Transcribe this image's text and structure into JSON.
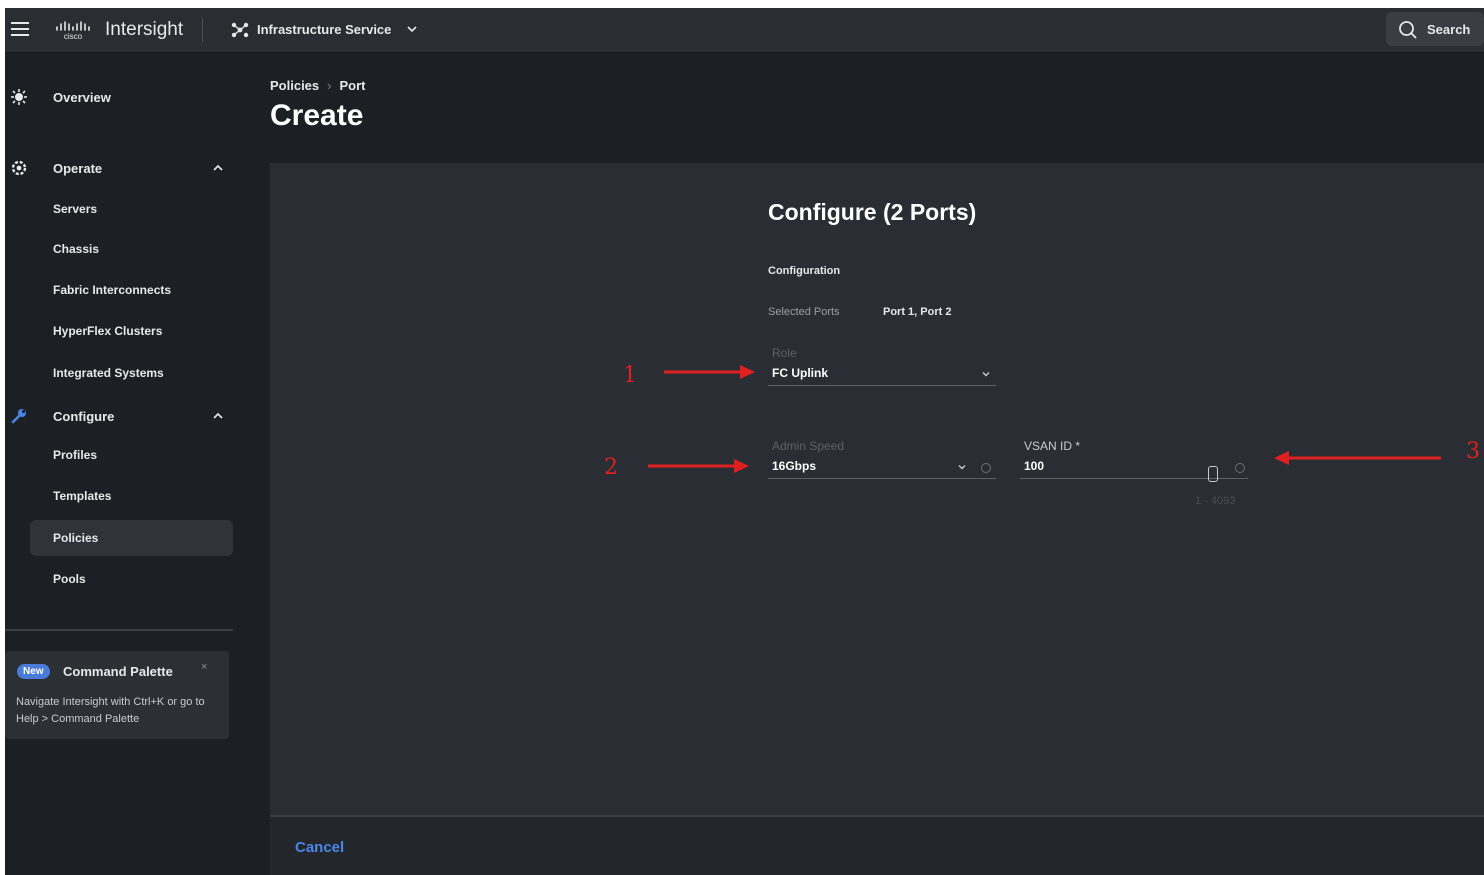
{
  "topbar": {
    "app_name": "Intersight",
    "service_name": "Infrastructure Service",
    "search_label": "Search"
  },
  "sidebar": {
    "overview": "Overview",
    "operate": "Operate",
    "operate_items": [
      "Servers",
      "Chassis",
      "Fabric Interconnects",
      "HyperFlex Clusters",
      "Integrated Systems"
    ],
    "configure": "Configure",
    "configure_items": [
      "Profiles",
      "Templates",
      "Policies",
      "Pools"
    ],
    "active_item": "Policies"
  },
  "palette": {
    "badge": "New",
    "title": "Command Palette",
    "close": "×",
    "description": "Navigate Intersight with Ctrl+K or go to Help > Command Palette"
  },
  "header": {
    "breadcrumb": [
      "Policies",
      "Port"
    ],
    "title": "Create"
  },
  "form": {
    "title": "Configure (2 Ports)",
    "section": "Configuration",
    "selected_ports_label": "Selected Ports",
    "selected_ports_value": "Port 1, Port 2",
    "role_label": "Role",
    "role_value": "FC Uplink",
    "admin_speed_label": "Admin Speed",
    "admin_speed_value": "16Gbps",
    "vsan_label": "VSAN ID *",
    "vsan_value": "100",
    "vsan_range": "1 - 4093"
  },
  "footer": {
    "cancel_label": "Cancel"
  },
  "annotations": [
    "1",
    "2",
    "3"
  ],
  "colors": {
    "accent": "#4a86e8",
    "annotation": "#e02020",
    "panel": "#2a2d33",
    "background": "#1c1f23"
  }
}
